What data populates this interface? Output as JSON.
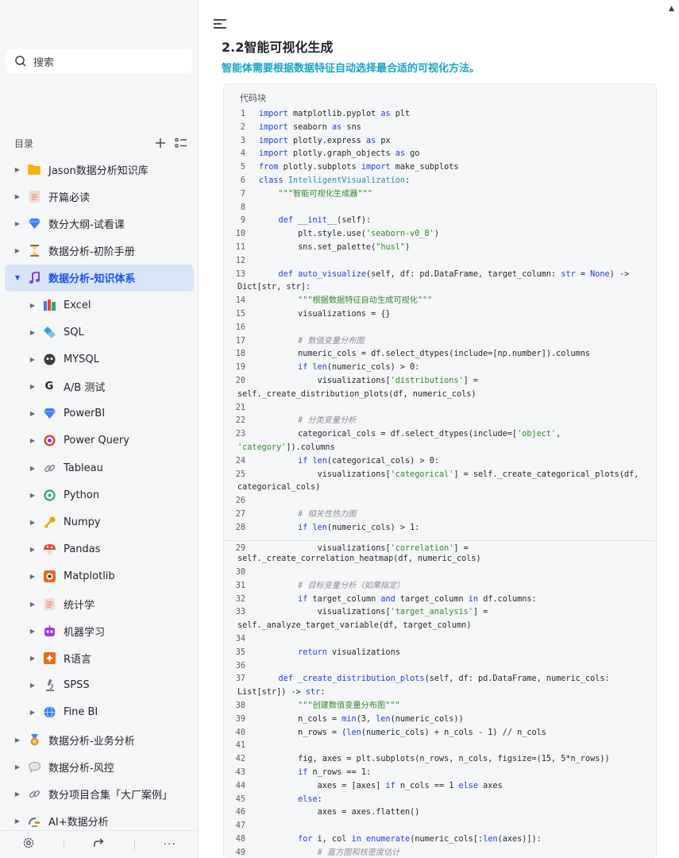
{
  "sidebar": {
    "search_placeholder": "搜索",
    "toc_title": "目录",
    "items": [
      {
        "label": "Jason数据分析知识库",
        "icon": "folder-icon",
        "color": "#f5b400",
        "level": 0
      },
      {
        "label": "开篇必读",
        "icon": "memo-icon",
        "color": "#e8927c",
        "level": 0
      },
      {
        "label": "数分大纲-试看课",
        "icon": "gem-icon",
        "color": "#3b82f6",
        "level": 0
      },
      {
        "label": "数据分析-初阶手册",
        "icon": "hourglass-icon",
        "color": "#c9a03a",
        "level": 0
      },
      {
        "label": "数据分析-知识体系",
        "icon": "music-note-icon",
        "color": "#7b3fe4",
        "level": 0,
        "active": true
      },
      {
        "label": "Excel",
        "icon": "books-icon",
        "color": "#3a7bd5",
        "level": 1
      },
      {
        "label": "SQL",
        "icon": "diamonds-icon",
        "color": "#29a3d6",
        "level": 1
      },
      {
        "label": "MYSQL",
        "icon": "mysql-icon",
        "color": "#3a3a3a",
        "level": 1
      },
      {
        "label": "A/B 测试",
        "icon": "g-icon",
        "color": "#222222",
        "level": 1
      },
      {
        "label": "PowerBI",
        "icon": "gem-icon",
        "color": "#3b82f6",
        "level": 1
      },
      {
        "label": "Power Query",
        "icon": "target-icon",
        "color": "#7b3fe4",
        "level": 1
      },
      {
        "label": "Tableau",
        "icon": "link-icon",
        "color": "#8a8f97",
        "level": 1
      },
      {
        "label": "Python",
        "icon": "python-icon",
        "color": "#2ea86b",
        "level": 1
      },
      {
        "label": "Numpy",
        "icon": "key-icon",
        "color": "#e0a800",
        "level": 1
      },
      {
        "label": "Pandas",
        "icon": "mushroom-icon",
        "color": "#e0443a",
        "level": 1
      },
      {
        "label": "Matplotlib",
        "icon": "matplotlib-icon",
        "color": "#e86a1a",
        "level": 1
      },
      {
        "label": "统计学",
        "icon": "memo-icon",
        "color": "#e8927c",
        "level": 1
      },
      {
        "label": "机器学习",
        "icon": "robot-icon",
        "color": "#a23bd6",
        "level": 1
      },
      {
        "label": "R语言",
        "icon": "r-icon",
        "color": "#f06a1a",
        "level": 1
      },
      {
        "label": "SPSS",
        "icon": "microscope-icon",
        "color": "#6b7280",
        "level": 1
      },
      {
        "label": "Fine BI",
        "icon": "globe-icon",
        "color": "#2f80ed",
        "level": 1
      },
      {
        "label": "数据分析-业务分析",
        "icon": "medal-icon",
        "color": "#d9962b",
        "level": 0
      },
      {
        "label": "数据分析-风控",
        "icon": "speech-bubble-icon",
        "color": "#9aa0a6",
        "level": 0
      },
      {
        "label": "数分项目合集「大厂案例」",
        "icon": "link-icon",
        "color": "#8a8f97",
        "level": 0
      },
      {
        "label": "AI+数据分析",
        "icon": "satellite-icon",
        "color": "#6b7280",
        "level": 0
      }
    ]
  },
  "main": {
    "heading": "2.2智能可视化生成",
    "subheading": "智能体需要根据数据特征自动选择最合适的可视化方法。",
    "code_block_label": "代码块"
  },
  "colors": {
    "accent": "#1456f0",
    "subheading": "#1aa3c8",
    "active_bg": "#d8e4f7"
  }
}
